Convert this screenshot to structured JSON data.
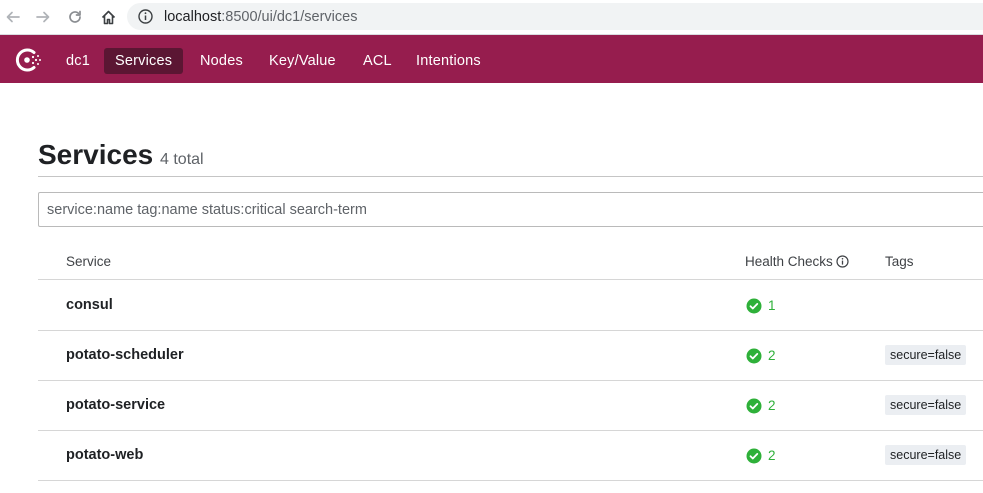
{
  "browser": {
    "url_host": "localhost",
    "url_rest": ":8500/ui/dc1/services"
  },
  "nav": {
    "datacenter": "dc1",
    "items": [
      {
        "label": "Services",
        "active": true
      },
      {
        "label": "Nodes",
        "active": false
      },
      {
        "label": "Key/Value",
        "active": false
      },
      {
        "label": "ACL",
        "active": false
      },
      {
        "label": "Intentions",
        "active": false
      }
    ]
  },
  "page": {
    "title": "Services",
    "count": "4 total",
    "search_placeholder": "service:name tag:name status:critical search-term"
  },
  "table": {
    "columns": [
      "Service",
      "Health Checks",
      "Tags"
    ],
    "rows": [
      {
        "name": "consul",
        "passing": "1",
        "tags": ""
      },
      {
        "name": "potato-scheduler",
        "passing": "2",
        "tags": "secure=false"
      },
      {
        "name": "potato-service",
        "passing": "2",
        "tags": "secure=false"
      },
      {
        "name": "potato-web",
        "passing": "2",
        "tags": "secure=false"
      }
    ]
  },
  "colors": {
    "brand": "#961d4e",
    "brand_active": "#5b1633",
    "passing": "#2eb039"
  }
}
